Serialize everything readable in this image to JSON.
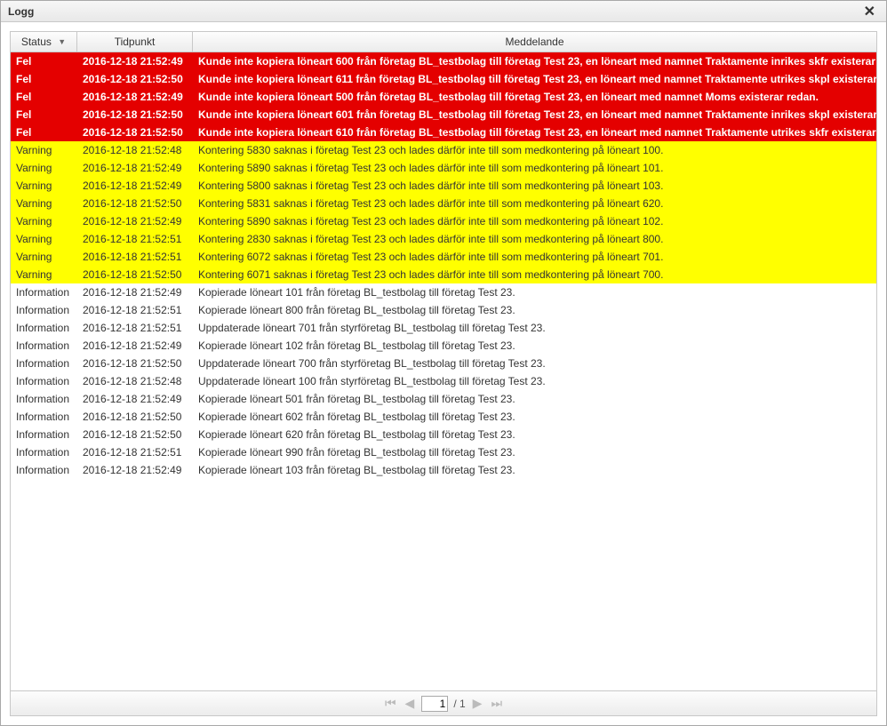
{
  "window": {
    "title": "Logg"
  },
  "columns": {
    "status": "Status",
    "time": "Tidpunkt",
    "message": "Meddelande"
  },
  "pager": {
    "page": "1",
    "total": "/ 1"
  },
  "rows": [
    {
      "type": "fel",
      "status": "Fel",
      "time": "2016-12-18 21:52:49",
      "msg": "Kunde inte kopiera löneart 600 från företag BL_testbolag till företag Test 23, en löneart med namnet Traktamente inrikes skfr existerar redan."
    },
    {
      "type": "fel",
      "status": "Fel",
      "time": "2016-12-18 21:52:50",
      "msg": "Kunde inte kopiera löneart 611 från företag BL_testbolag till företag Test 23, en löneart med namnet Traktamente utrikes skpl existerar redan."
    },
    {
      "type": "fel",
      "status": "Fel",
      "time": "2016-12-18 21:52:49",
      "msg": "Kunde inte kopiera löneart 500 från företag BL_testbolag till företag Test 23, en löneart med namnet Moms existerar redan."
    },
    {
      "type": "fel",
      "status": "Fel",
      "time": "2016-12-18 21:52:50",
      "msg": "Kunde inte kopiera löneart 601 från företag BL_testbolag till företag Test 23, en löneart med namnet Traktamente inrikes skpl existerar redan."
    },
    {
      "type": "fel",
      "status": "Fel",
      "time": "2016-12-18 21:52:50",
      "msg": "Kunde inte kopiera löneart 610 från företag BL_testbolag till företag Test 23, en löneart med namnet Traktamente utrikes skfr existerar redan."
    },
    {
      "type": "varning",
      "status": "Varning",
      "time": "2016-12-18 21:52:48",
      "msg": "Kontering 5830 saknas i företag Test 23 och lades därför inte till som medkontering på löneart 100."
    },
    {
      "type": "varning",
      "status": "Varning",
      "time": "2016-12-18 21:52:49",
      "msg": "Kontering 5890 saknas i företag Test 23 och lades därför inte till som medkontering på löneart 101."
    },
    {
      "type": "varning",
      "status": "Varning",
      "time": "2016-12-18 21:52:49",
      "msg": "Kontering 5800 saknas i företag Test 23 och lades därför inte till som medkontering på löneart 103."
    },
    {
      "type": "varning",
      "status": "Varning",
      "time": "2016-12-18 21:52:50",
      "msg": "Kontering 5831 saknas i företag Test 23 och lades därför inte till som medkontering på löneart 620."
    },
    {
      "type": "varning",
      "status": "Varning",
      "time": "2016-12-18 21:52:49",
      "msg": "Kontering 5890 saknas i företag Test 23 och lades därför inte till som medkontering på löneart 102."
    },
    {
      "type": "varning",
      "status": "Varning",
      "time": "2016-12-18 21:52:51",
      "msg": "Kontering 2830 saknas i företag Test 23 och lades därför inte till som medkontering på löneart 800."
    },
    {
      "type": "varning",
      "status": "Varning",
      "time": "2016-12-18 21:52:51",
      "msg": "Kontering 6072 saknas i företag Test 23 och lades därför inte till som medkontering på löneart 701."
    },
    {
      "type": "varning",
      "status": "Varning",
      "time": "2016-12-18 21:52:50",
      "msg": "Kontering 6071 saknas i företag Test 23 och lades därför inte till som medkontering på löneart 700."
    },
    {
      "type": "information",
      "status": "Information",
      "time": "2016-12-18 21:52:49",
      "msg": "Kopierade löneart 101 från företag BL_testbolag till företag Test 23."
    },
    {
      "type": "information",
      "status": "Information",
      "time": "2016-12-18 21:52:51",
      "msg": "Kopierade löneart 800 från företag BL_testbolag till företag Test 23."
    },
    {
      "type": "information",
      "status": "Information",
      "time": "2016-12-18 21:52:51",
      "msg": "Uppdaterade löneart 701 från styrföretag BL_testbolag till företag Test 23."
    },
    {
      "type": "information",
      "status": "Information",
      "time": "2016-12-18 21:52:49",
      "msg": "Kopierade löneart 102 från företag BL_testbolag till företag Test 23."
    },
    {
      "type": "information",
      "status": "Information",
      "time": "2016-12-18 21:52:50",
      "msg": "Uppdaterade löneart 700 från styrföretag BL_testbolag till företag Test 23."
    },
    {
      "type": "information",
      "status": "Information",
      "time": "2016-12-18 21:52:48",
      "msg": "Uppdaterade löneart 100 från styrföretag BL_testbolag till företag Test 23."
    },
    {
      "type": "information",
      "status": "Information",
      "time": "2016-12-18 21:52:49",
      "msg": "Kopierade löneart 501 från företag BL_testbolag till företag Test 23."
    },
    {
      "type": "information",
      "status": "Information",
      "time": "2016-12-18 21:52:50",
      "msg": "Kopierade löneart 602 från företag BL_testbolag till företag Test 23."
    },
    {
      "type": "information",
      "status": "Information",
      "time": "2016-12-18 21:52:50",
      "msg": "Kopierade löneart 620 från företag BL_testbolag till företag Test 23."
    },
    {
      "type": "information",
      "status": "Information",
      "time": "2016-12-18 21:52:51",
      "msg": "Kopierade löneart 990 från företag BL_testbolag till företag Test 23."
    },
    {
      "type": "information",
      "status": "Information",
      "time": "2016-12-18 21:52:49",
      "msg": "Kopierade löneart 103 från företag BL_testbolag till företag Test 23."
    }
  ]
}
